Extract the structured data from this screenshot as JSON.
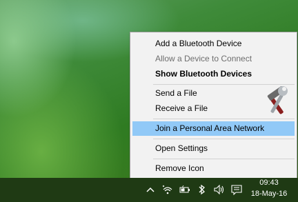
{
  "menu": {
    "items": [
      {
        "label": "Add a Bluetooth Device"
      },
      {
        "label": "Allow a Device to Connect"
      },
      {
        "label": "Show Bluetooth Devices"
      },
      {
        "label": "Send a File"
      },
      {
        "label": "Receive a File"
      },
      {
        "label": "Join a Personal Area Network"
      },
      {
        "label": "Open Settings"
      },
      {
        "label": "Remove Icon"
      }
    ],
    "disabled_item": "Allow a Device to Connect",
    "highlighted_item": "Join a Personal Area Network",
    "highlight_color": "#91c9f7"
  },
  "taskbar": {
    "background": "#1f3a14",
    "tray_icons": [
      "chevron-up-icon",
      "wifi-icon",
      "battery-icon",
      "bluetooth-icon",
      "volume-icon",
      "action-center-icon"
    ],
    "clock": {
      "time": "09:43",
      "date": "18-May-16"
    }
  }
}
